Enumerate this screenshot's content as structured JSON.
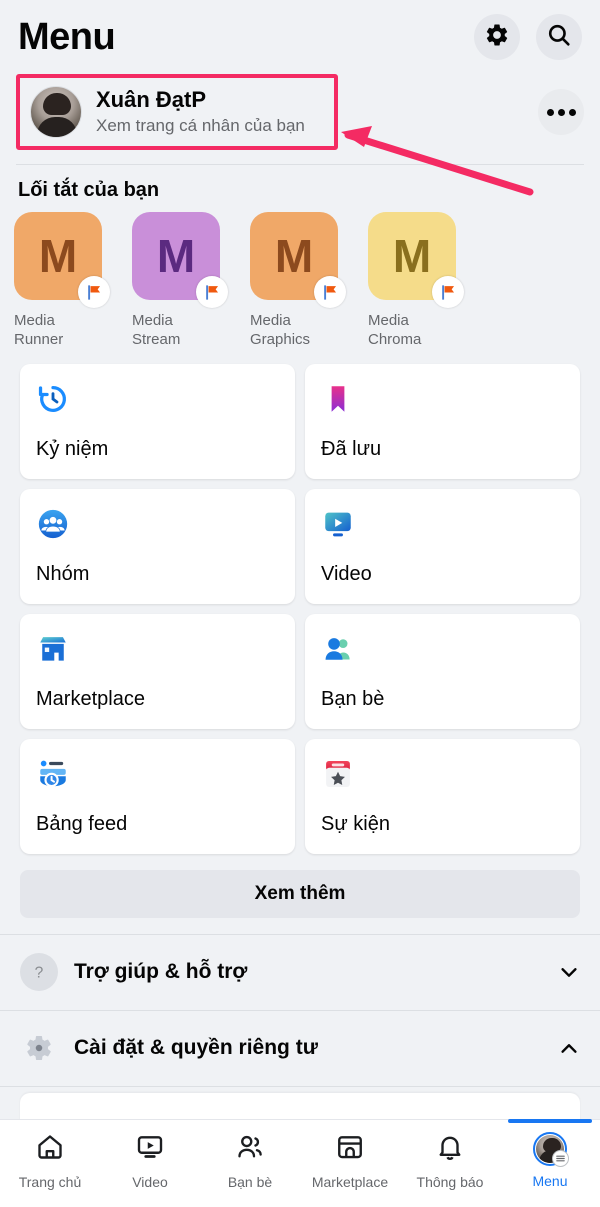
{
  "header": {
    "title": "Menu",
    "settings_icon": "gear-icon",
    "search_icon": "search-icon"
  },
  "profile": {
    "name": "Xuân ĐạtP",
    "subtitle": "Xem trang cá nhân của bạn",
    "avatar_icon": "user-avatar",
    "more_icon": "more-dots-icon",
    "highlight_color": "#f42b63"
  },
  "shortcuts": {
    "title": "Lối tắt của bạn",
    "items": [
      {
        "letter": "M",
        "line1": "Media",
        "line2": "Runner",
        "bg": "#f0a868",
        "fg": "#8c4a1e",
        "badge": "flag-icon"
      },
      {
        "letter": "M",
        "line1": "Media",
        "line2": "Stream",
        "bg": "#c98fd9",
        "fg": "#5b2a80",
        "badge": "flag-icon"
      },
      {
        "letter": "M",
        "line1": "Media",
        "line2": "Graphics",
        "bg": "#f0a868",
        "fg": "#8c4a1e",
        "badge": "flag-icon"
      },
      {
        "letter": "M",
        "line1": "Media",
        "line2": "Chroma",
        "bg": "#f5dc8a",
        "fg": "#8a6f1e",
        "badge": "flag-icon"
      }
    ]
  },
  "menu_grid": [
    {
      "label": "Kỷ niệm",
      "icon": "memories-clock-icon"
    },
    {
      "label": "Đã lưu",
      "icon": "bookmark-icon"
    },
    {
      "label": "Nhóm",
      "icon": "groups-icon"
    },
    {
      "label": "Video",
      "icon": "video-icon"
    },
    {
      "label": "Marketplace",
      "icon": "marketplace-icon"
    },
    {
      "label": "Bạn bè",
      "icon": "friends-icon"
    },
    {
      "label": "Bảng feed",
      "icon": "feeds-icon"
    },
    {
      "label": "Sự kiện",
      "icon": "events-calendar-icon"
    }
  ],
  "see_more": {
    "label": "Xem thêm"
  },
  "collapsible_rows": [
    {
      "label": "Trợ giúp & hỗ trợ",
      "icon": "question-mark-icon",
      "chevron": "chevron-down-icon",
      "expanded": false
    },
    {
      "label": "Cài đặt & quyền riêng tư",
      "icon": "gear-icon",
      "chevron": "chevron-up-icon",
      "expanded": true
    }
  ],
  "bottom_nav": {
    "active_color": "#1877f2",
    "items": [
      {
        "label": "Trang chủ",
        "icon": "home-icon",
        "active": false
      },
      {
        "label": "Video",
        "icon": "video-icon",
        "active": false
      },
      {
        "label": "Bạn bè",
        "icon": "friends-icon",
        "active": false
      },
      {
        "label": "Marketplace",
        "icon": "marketplace-icon",
        "active": false
      },
      {
        "label": "Thông báo",
        "icon": "bell-icon",
        "active": false
      },
      {
        "label": "Menu",
        "icon": "profile-menu-avatar-icon",
        "active": true
      }
    ]
  },
  "annotation": {
    "type": "arrow-pointing-to-profile-row",
    "color": "#f42b63"
  }
}
